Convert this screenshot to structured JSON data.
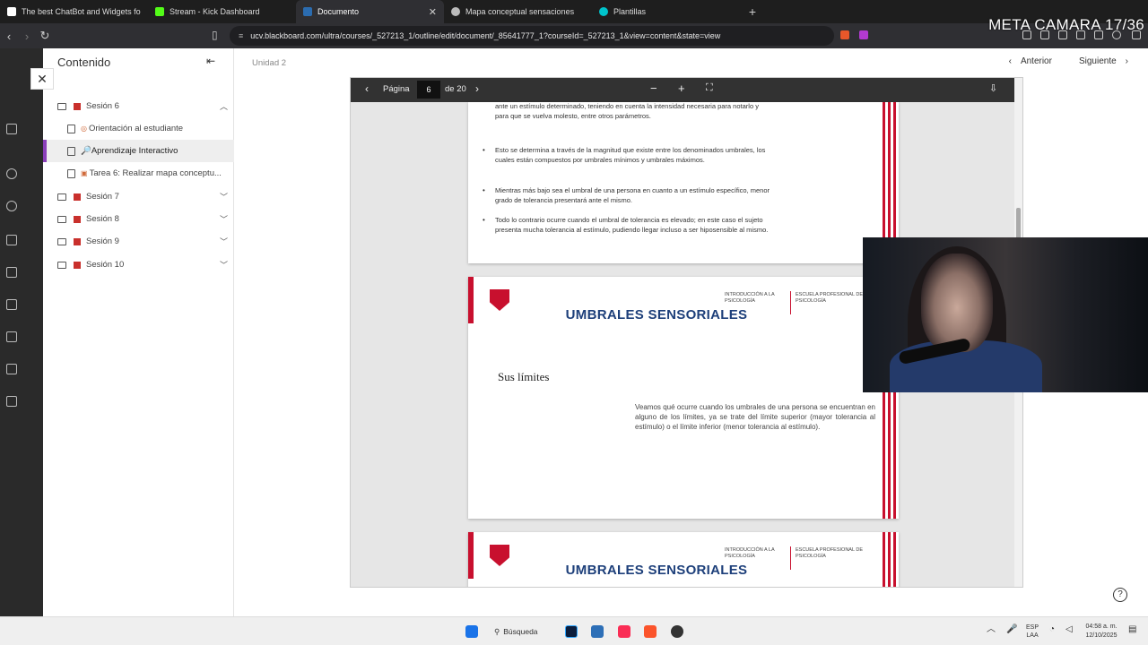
{
  "tabs": [
    {
      "label": "The best ChatBot and Widgets fo",
      "color": "#ffffff"
    },
    {
      "label": "Stream - Kick Dashboard",
      "color": "#53fc18"
    },
    {
      "label": "Documento",
      "color": "#2b6cb0",
      "active": true
    },
    {
      "label": "Mapa conceptual sensaciones",
      "color": "#bbbbbb"
    },
    {
      "label": "Plantillas",
      "color": "#00c4cc"
    }
  ],
  "new_tab": "+",
  "overlay_text": "META CAMARA 17/36",
  "url": "ucv.blackboard.com/ultra/courses/_527213_1/outline/edit/document/_85641777_1?courseId=_527213_1&view=content&state=view",
  "sidebar": {
    "title": "Contenido",
    "items": [
      {
        "label": "Sesión 6",
        "type": "folder"
      },
      {
        "label": "Orientación al estudiante",
        "type": "doc"
      },
      {
        "label": "🔎Aprendizaje Interactivo",
        "type": "doc",
        "selected": true
      },
      {
        "label": "Tarea 6: Realizar mapa conceptu...",
        "type": "task"
      },
      {
        "label": "Sesión 7",
        "type": "folder"
      },
      {
        "label": "Sesión 8",
        "type": "folder"
      },
      {
        "label": "Sesión 9",
        "type": "folder"
      },
      {
        "label": "Sesión 10",
        "type": "folder"
      }
    ]
  },
  "header": {
    "unit": "Unidad 2",
    "prev": "Anterior",
    "next": "Siguiente"
  },
  "viewer": {
    "page_label": "Página",
    "page": "6",
    "of": "de 20"
  },
  "page1": {
    "line_top": "ante un estímulo determinado, teniendo en cuenta la intensidad necesaria para notarlo y para que se vuelva molesto, entre otros parámetros.",
    "b1": "Esto se determina a través de la magnitud que existe entre los denominados umbrales, los cuales están compuestos por umbrales mínimos y umbrales máximos.",
    "b2": "Mientras más bajo sea el umbral de una persona en cuanto a un estímulo específico, menor grado de tolerancia presentará ante el mismo.",
    "b3": "Todo lo contrario ocurre cuando el umbral de tolerancia es elevado; en este caso el sujeto presenta mucha tolerancia al estímulo, pudiendo llegar incluso a ser hiposensible al mismo."
  },
  "slide": {
    "title": "UMBRALES SENSORIALES",
    "hdr_left": "INTRODUCCIÓN A LA\nPSICOLOGÍA",
    "hdr_right": "ESCUELA PROFESIONAL DE\nPSICOLOGÍA",
    "subtitle": "Sus límites",
    "paragraph": "Veamos qué ocurre cuando los umbrales de una persona se encuentran en alguno de los límites, ya se trate del límite superior (mayor tolerancia al estímulo) o el límite inferior (menor tolerancia al estímulo)."
  },
  "taskbar": {
    "search": "Búsqueda",
    "lang": "ESP\nLAA",
    "time": "04:58 a. m.",
    "date": "12/10/2025"
  }
}
